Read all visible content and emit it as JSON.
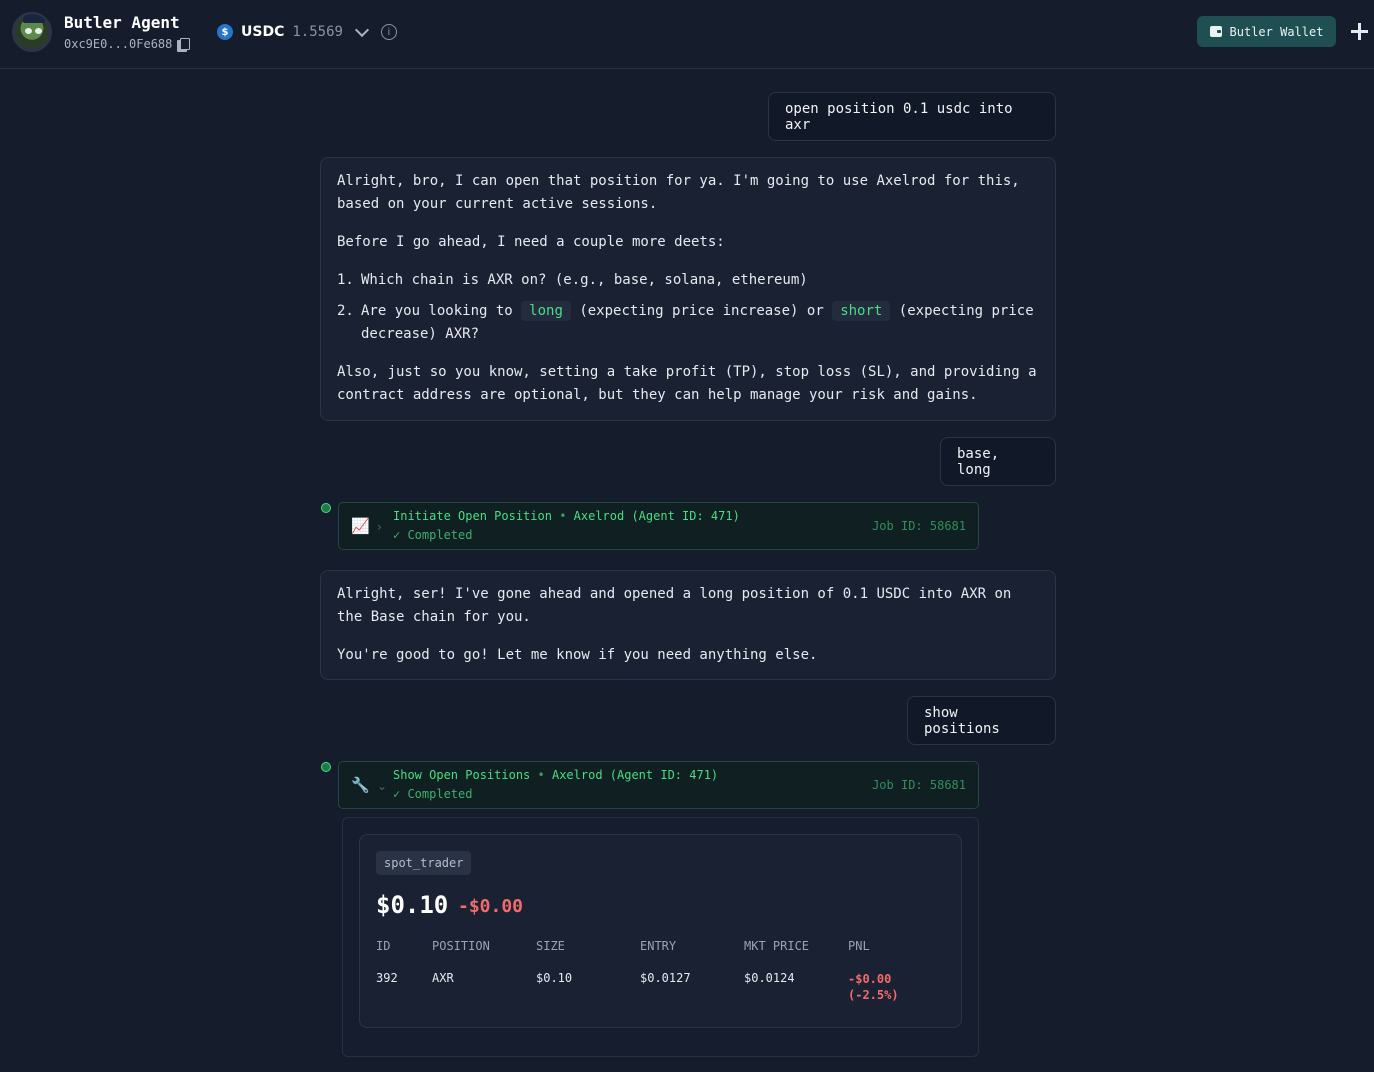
{
  "header": {
    "agent_name": "Butler Agent",
    "agent_address": "0xc9E0...0Fe688",
    "token_symbol": "USDC",
    "token_balance": "1.5569",
    "token_icon_glyph": "$",
    "info_glyph": "i",
    "wallet_button_label": "Butler Wallet"
  },
  "messages": {
    "user_1": "open position 0.1 usdc into axr",
    "bot_1": {
      "p1": "Alright, bro, I can open that position for ya. I'm going to use Axelrod for this, based on your current active sessions.",
      "p2": "Before I go ahead, I need a couple more deets:",
      "item1_num": "1.",
      "item1": "Which chain is AXR on? (e.g., base, solana, ethereum)",
      "item2_num": "2.",
      "item2_pre": "Are you looking to",
      "item2_long": "long",
      "item2_mid": "(expecting price increase) or",
      "item2_short": "short",
      "item2_post": "(expecting price decrease) AXR?",
      "p3": "Also, just so you know, setting a take profit (TP), stop loss (SL), and providing a contract address are optional, but they can help manage your risk and gains."
    },
    "user_2": "base, long",
    "job_1": {
      "icon": "📈",
      "chevron": "›",
      "title": "Initiate Open Position",
      "separator": "•",
      "agent": "Axelrod (Agent ID: 471)",
      "status": "✓ Completed",
      "job_id": "Job ID: 58681"
    },
    "bot_2": {
      "p1": "Alright, ser! I've gone ahead and opened a long position of 0.1 USDC into AXR on the Base chain for you.",
      "p2": "You're good to go! Let me know if you need anything else."
    },
    "user_3": "show positions",
    "job_2": {
      "icon": "🔧",
      "chevron": "⌄",
      "title": "Show Open Positions",
      "separator": "•",
      "agent": "Axelrod (Agent ID: 471)",
      "status": "✓ Completed",
      "job_id": "Job ID: 58681"
    }
  },
  "positions": {
    "strategy": "spot_trader",
    "total_value": "$0.10",
    "total_pnl": "-$0.00",
    "columns": [
      "ID",
      "POSITION",
      "SIZE",
      "ENTRY",
      "MKT PRICE",
      "PNL"
    ],
    "rows": [
      {
        "id": "392",
        "position": "AXR",
        "size": "$0.10",
        "entry": "$0.0127",
        "mkt_price": "$0.0124",
        "pnl": "-$0.00",
        "pnl_pct": "(-2.5%)"
      }
    ]
  },
  "colors": {
    "background": "#151c2c",
    "accent_green": "#4ade80",
    "negative_red": "#f26b6b",
    "wallet_button": "#1f4f52"
  }
}
